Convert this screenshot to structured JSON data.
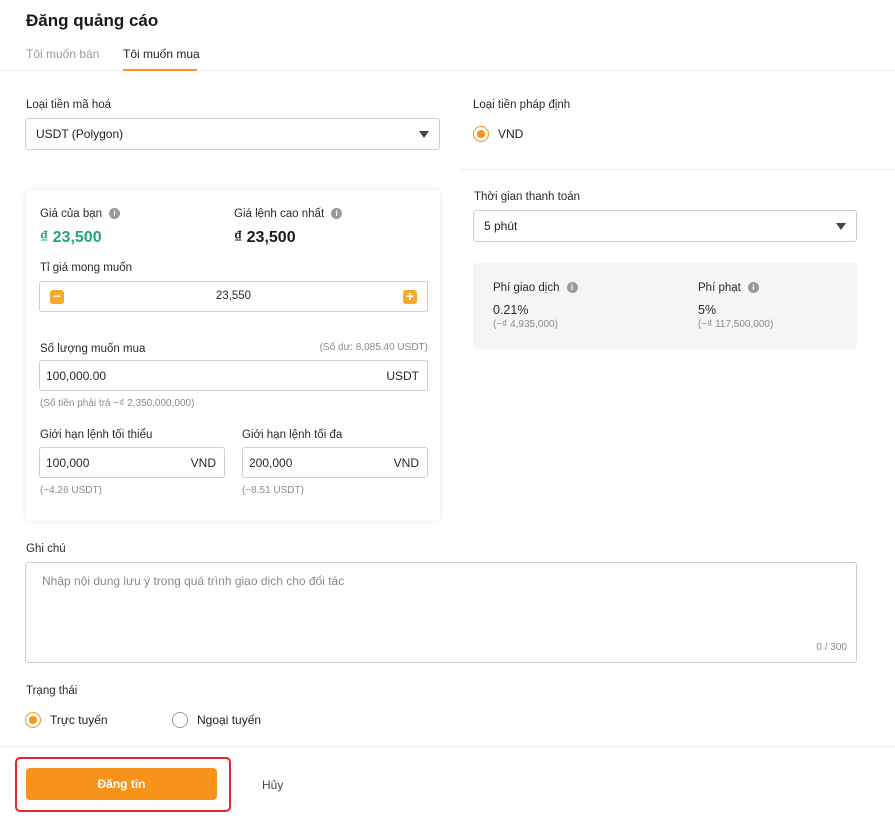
{
  "page": {
    "title": "Đăng quảng cáo"
  },
  "tabs": {
    "sell": "Tôi muốn bán",
    "buy": "Tôi muốn mua",
    "active": "buy"
  },
  "crypto": {
    "label": "Loại tiền mã hoá",
    "value": "USDT (Polygon)"
  },
  "fiat": {
    "label": "Loại tiền pháp định",
    "option": "VND",
    "selected": true
  },
  "price_card": {
    "your_price_label": "Giá của bạn",
    "your_price": "₫ 23,500",
    "highest_price_label": "Giá lệnh cao nhất",
    "highest_price": "₫ 23,500",
    "rate_label": "Tỉ giá mong muốn",
    "rate_value": "23,550",
    "minus_glyph": "−",
    "plus_glyph": "+",
    "qty_label": "Số lượng muốn mua",
    "balance": "(Số dư: 8,085.40 USDT)",
    "qty_value": "100,000.00",
    "qty_unit": "USDT",
    "pay_amount": "(Số tiền phải trả ~₫ 2,350,000,000)",
    "min_label": "Giới hạn lệnh tối thiểu",
    "min_value": "100,000",
    "min_unit": "VND",
    "min_hint": "(~4.26 USDT)",
    "max_label": "Giới hạn lệnh tối đa",
    "max_value": "200,000",
    "max_unit": "VND",
    "max_hint": "(~8.51 USDT)"
  },
  "payment_time": {
    "label": "Thời gian thanh toán",
    "value": "5 phút"
  },
  "fees": {
    "trade_fee_label": "Phí giao dịch",
    "trade_fee": "0.21%",
    "trade_fee_amount": "(~₫ 4,935,000)",
    "penalty_label": "Phí phạt",
    "penalty": "5%",
    "penalty_amount": "(~₫ 117,500,000)"
  },
  "note": {
    "label": "Ghi chú",
    "placeholder": "Nhập nội dung lưu ý trong quá trình giao dịch cho đối tác",
    "counter": "0 / 300"
  },
  "status": {
    "label": "Trạng thái",
    "online": "Trực tuyến",
    "offline": "Ngoại tuyến",
    "selected": "online"
  },
  "actions": {
    "submit": "Đăng tin",
    "cancel": "Hủy"
  },
  "info_glyph": "i",
  "colors": {
    "accent": "#f7931a",
    "green": "#1fa877",
    "highlight": "#e8242a"
  }
}
